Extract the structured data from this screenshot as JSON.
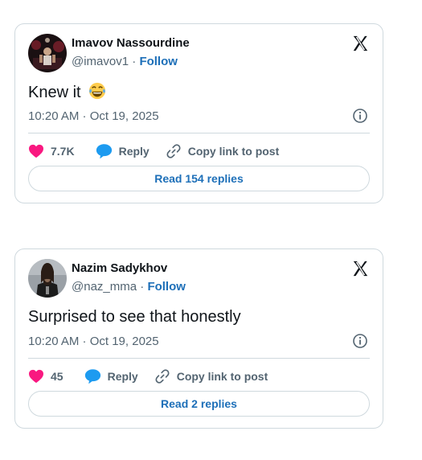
{
  "colors": {
    "accent": "#1d6fb8",
    "muted": "#536471",
    "heart": "#f91880",
    "reply_icon": "#1d9bf0",
    "border": "#cfd9de"
  },
  "tweets": [
    {
      "name": "Imavov Nassourdine",
      "handle": "@imavov1",
      "separator": "·",
      "follow_label": "Follow",
      "text": "Knew it",
      "emoji": "face-with-tears-of-joy",
      "timestamp": "10:20 AM · Oct 19, 2025",
      "like_count": "7.7K",
      "reply_label": "Reply",
      "copy_label": "Copy link to post",
      "read_replies_label": "Read 154 replies",
      "icons": [
        "x-logo-icon",
        "info-icon",
        "heart-icon",
        "reply-bubble-icon",
        "link-icon"
      ]
    },
    {
      "name": "Nazim Sadykhov",
      "handle": "@naz_mma",
      "separator": "·",
      "follow_label": "Follow",
      "text": "Surprised to see that honestly",
      "timestamp": "10:20 AM · Oct 19, 2025",
      "like_count": "45",
      "reply_label": "Reply",
      "copy_label": "Copy link to post",
      "read_replies_label": "Read 2 replies",
      "icons": [
        "x-logo-icon",
        "info-icon",
        "heart-icon",
        "reply-bubble-icon",
        "link-icon"
      ]
    }
  ]
}
